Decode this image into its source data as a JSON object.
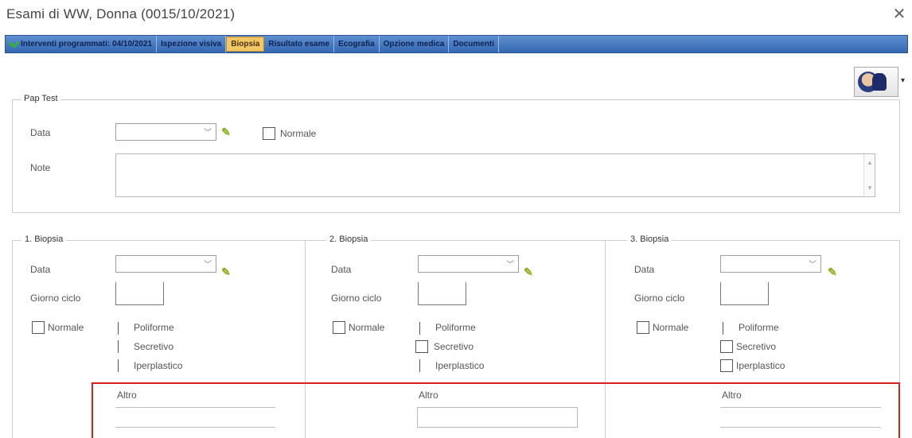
{
  "window": {
    "title": "Esami di WW, Donna (0015/10/2021)",
    "close_glyph": "✕"
  },
  "tabs": [
    {
      "label": "Interventi programmati: 04/10/2021",
      "icon": "check-icon",
      "active": false
    },
    {
      "label": "Ispezione visiva",
      "active": false
    },
    {
      "label": "Biopsia",
      "active": true
    },
    {
      "label": "Risultato esame",
      "active": false
    },
    {
      "label": "Ecografia",
      "active": false
    },
    {
      "label": "Opzione medica",
      "active": false
    },
    {
      "label": "Documenti",
      "active": false
    }
  ],
  "toolbar": {
    "avatar_icon": "user-avatar-icon",
    "dropdown_glyph": "▾"
  },
  "pap_test": {
    "legend": "Pap Test",
    "data_label": "Data",
    "data_value": "",
    "normale_label": "Normale",
    "note_label": "Note",
    "note_value": ""
  },
  "biopsies": [
    {
      "legend": "1. Biopsia",
      "data_label": "Data",
      "giorno_label": "Giorno ciclo",
      "normale_label": "Normale",
      "options": [
        "Poliforme",
        "Secretivo",
        "Iperplastico"
      ],
      "altro_label": "Altro"
    },
    {
      "legend": "2. Biopsia",
      "data_label": "Data",
      "giorno_label": "Giorno ciclo",
      "normale_label": "Normale",
      "options": [
        "Poliforme",
        "Secretivo",
        "Iperplastico"
      ],
      "altro_label": "Altro"
    },
    {
      "legend": "3. Biopsia",
      "data_label": "Data",
      "giorno_label": "Giorno ciclo",
      "normale_label": "Normale",
      "options": [
        "Poliforme",
        "Secretivo",
        "Iperplastico"
      ],
      "altro_label": "Altro"
    }
  ],
  "colors": {
    "highlight_border": "#d9221e",
    "active_tab": "#f2c766",
    "tabbar": "#3568b3"
  }
}
